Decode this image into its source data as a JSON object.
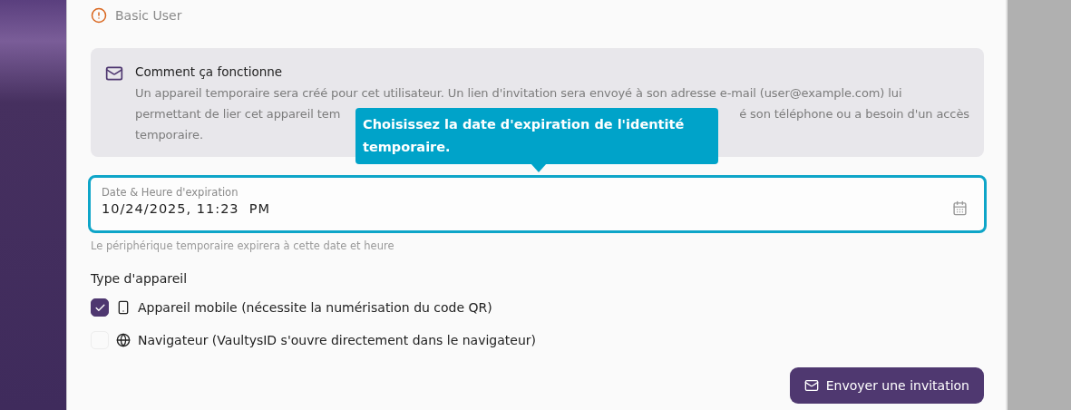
{
  "user_role": {
    "label": "Basic User"
  },
  "info": {
    "title": "Comment ça fonctionne",
    "lines": [
      "Un appareil temporaire sera créé pour cet utilisateur. Un lien d'invitation sera envoyé à son adresse e-mail (user@example.com) lui",
      "permettant de lier cet appareil tem",
      "é son téléphone ou a besoin d'un accès",
      "temporaire."
    ]
  },
  "tooltip": {
    "text": "Choisissez la date d'expiration de l'identité temporaire."
  },
  "expiration_field": {
    "label": "Date & Heure d'expiration",
    "value": "10/24/2025, 11:23  PM",
    "helper": "Le périphérique temporaire expirera à cette date et heure"
  },
  "device_type": {
    "title": "Type d'appareil",
    "options": [
      {
        "kind": "mobile",
        "label": "Appareil mobile (nécessite la numérisation du code QR)",
        "selected": true
      },
      {
        "kind": "browser",
        "label": "Navigateur (VaultysID s'ouvre directement dans le navigateur)",
        "selected": false
      }
    ]
  },
  "submit_button": {
    "label": "Envoyer une invitation"
  }
}
